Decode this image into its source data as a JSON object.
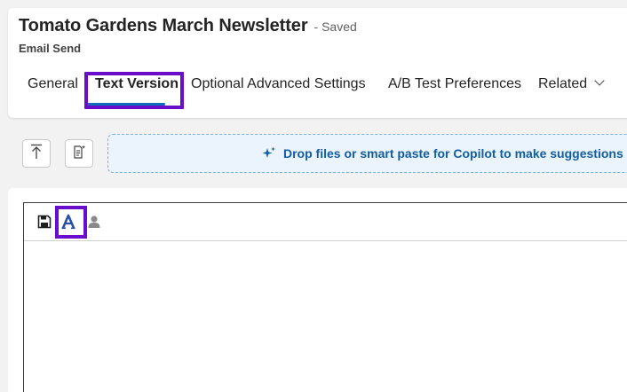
{
  "header": {
    "title": "Tomato Gardens March Newsletter",
    "saved_status": "- Saved",
    "entity_type": "Email Send"
  },
  "tabs": [
    {
      "label": "General",
      "active": false
    },
    {
      "label": "Text Version",
      "active": true
    },
    {
      "label": "Optional Advanced Settings",
      "active": false
    },
    {
      "label": "A/B Test Preferences",
      "active": false
    },
    {
      "label": "Related",
      "active": false
    }
  ],
  "toolbar": {
    "upload_icon": "upload-icon",
    "smart_paste_icon": "smart-paste-icon",
    "drop_zone_text": "Drop files or smart paste for Copilot to make suggestions"
  },
  "editor": {
    "toolbar_icons": [
      "save-icon",
      "font-icon",
      "personalize-icon"
    ],
    "body_text": ""
  },
  "colors": {
    "accent": "#0f6cbd",
    "highlight": "#6a0dcb",
    "drop_zone_bg": "#ebf3fc",
    "drop_zone_text": "#115ea3"
  }
}
